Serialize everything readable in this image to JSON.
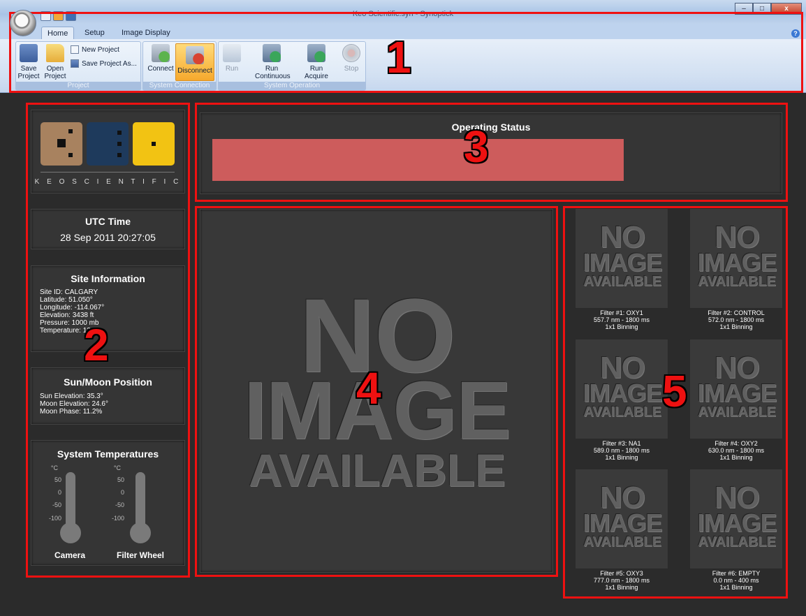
{
  "window": {
    "title": "Keo Scientific.syn - Synoptick",
    "minimize": "–",
    "maximize": "□",
    "close": "x"
  },
  "ribbon": {
    "tabs": [
      "Home",
      "Setup",
      "Image Display"
    ],
    "project": {
      "save": "Save Project",
      "open": "Open Project",
      "new_project": "New Project",
      "save_as": "Save Project As...",
      "label": "Project"
    },
    "connection": {
      "connect": "Connect",
      "disconnect": "Disconnect",
      "label": "System Connection"
    },
    "operation": {
      "run": "Run",
      "run_continuous": "Run Continuous ▾",
      "run_acquire": "Run Acquire ▾",
      "stop": "Stop",
      "label": "System Operation"
    }
  },
  "logo": {
    "text": "K E O S C I E N T I F I C",
    "colors": [
      "#a8825f",
      "#1e3a5c",
      "#f2c313"
    ]
  },
  "utc": {
    "title": "UTC Time",
    "value": "28 Sep 2011 20:27:05"
  },
  "site": {
    "title": "Site Information",
    "lines": [
      "Site ID: CALGARY",
      "Latitude: 51.050°",
      "Longitude: -114.067°",
      "Elevation: 3438 ft",
      "Pressure: 1000 mb",
      "Temperature: 13.0"
    ]
  },
  "sunmoon": {
    "title": "Sun/Moon Position",
    "lines": [
      "Sun Elevation: 35.3°",
      "Moon Elevation: 24.6°",
      "Moon Phase: 11.2%"
    ]
  },
  "temps": {
    "title": "System Temperatures",
    "unit": "°C",
    "ticks": [
      "50",
      "0",
      "-50",
      "-100"
    ],
    "camera": "Camera",
    "wheel": "Filter Wheel"
  },
  "status": {
    "title": "Operating Status",
    "bar_color": "#cd5c5c"
  },
  "main_image": {
    "l1": "NO",
    "l2": "IMAGE",
    "l3": "AVAILABLE"
  },
  "filters": [
    {
      "name": "Filter #1: OXY1",
      "spec": "557.7 nm  -  1800 ms",
      "binning": "1x1 Binning"
    },
    {
      "name": "Filter #2: CONTROL",
      "spec": "572.0 nm  -  1800 ms",
      "binning": "1x1 Binning"
    },
    {
      "name": "Filter #3: NA1",
      "spec": "589.0 nm  -  1800 ms",
      "binning": "1x1 Binning"
    },
    {
      "name": "Filter #4: OXY2",
      "spec": "630.0 nm  -  1800 ms",
      "binning": "1x1 Binning"
    },
    {
      "name": "Filter #5: OXY3",
      "spec": "777.0 nm  -  1800 ms",
      "binning": "1x1 Binning"
    },
    {
      "name": "Filter #6: EMPTY",
      "spec": "0.0 nm  -  400 ms",
      "binning": "1x1 Binning"
    }
  ],
  "callouts": [
    "1",
    "2",
    "3",
    "4",
    "5"
  ]
}
